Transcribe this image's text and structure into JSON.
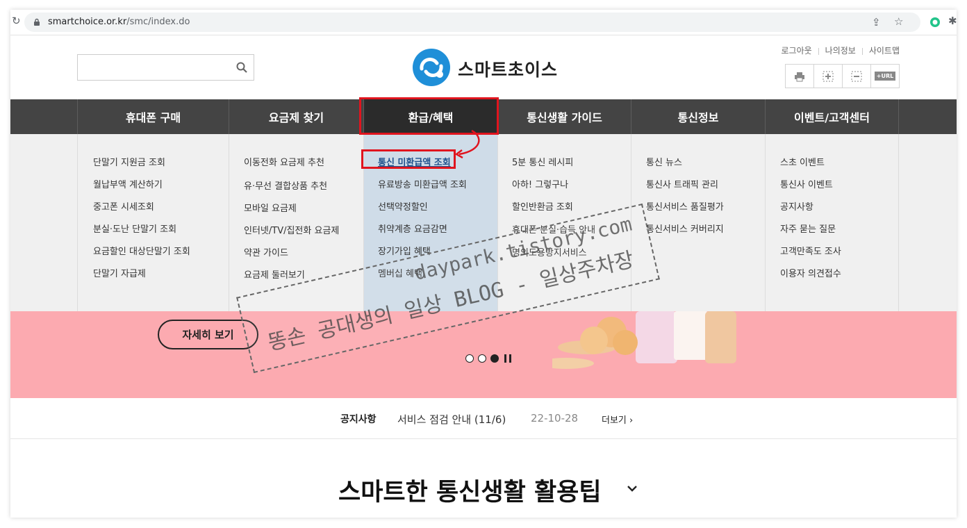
{
  "browser": {
    "url_domain": "smartchoice.or.kr",
    "url_path": "/smc/index.do"
  },
  "header": {
    "search": {
      "placeholder": "",
      "value": ""
    },
    "logo_text": "스마트초이스",
    "util_links": [
      "로그아웃",
      "나의정보",
      "사이트맵"
    ],
    "util_icons": [
      "print-icon",
      "zoom-in-icon",
      "zoom-out-icon",
      "url-icon"
    ],
    "url_icon_label": "+URL"
  },
  "nav": {
    "items": [
      "휴대폰 구매",
      "요금제 찾기",
      "환급/혜택",
      "통신생활 가이드",
      "통신정보",
      "이벤트/고객센터"
    ],
    "active_index": 2
  },
  "dropdown": {
    "columns": [
      [
        "단말기 지원금 조회",
        "월납부액 계산하기",
        "중고폰 시세조회",
        "분실·도난 단말기 조회",
        "요금할인 대상단말기 조회",
        "단말기 자급제"
      ],
      [
        "이동전화 요금제 추천",
        "유·무선 결합상품 추천",
        "모바일 요금제",
        "인터넷/TV/집전화 요금제",
        "약관 가이드",
        "요금제 둘러보기"
      ],
      [
        "통신 미환급액 조회",
        "유료방송 미환급액 조회",
        "선택약정할인",
        "취약계층 요금감면",
        "장기가입 혜택",
        "멤버십 혜택"
      ],
      [
        "5분 통신 레시피",
        "아하! 그렇구나",
        "할인반환금 조회",
        "휴대폰 분실·습득 안내",
        "명의도용방지서비스"
      ],
      [
        "통신 뉴스",
        "통신사 트래픽 관리",
        "통신서비스 품질평가",
        "통신서비스 커버리지"
      ],
      [
        "스초 이벤트",
        "통신사 이벤트",
        "공지사항",
        "자주 묻는 질문",
        "고객만족도 조사",
        "이용자 의견접수"
      ]
    ],
    "selected": {
      "column": 2,
      "item": 0
    }
  },
  "banner": {
    "button_label": "자세히 보기",
    "slides": 3,
    "current_slide": 3
  },
  "notice": {
    "label": "공지사항",
    "title": "서비스 점검 안내 (11/6)",
    "date": "22-10-28",
    "more": "더보기 ›"
  },
  "section": {
    "title": "스마트한 통신생활 활용팁"
  },
  "watermark": {
    "line1": "daypark.tistory.com",
    "line2": "똥손 공대생의 일상 BLOG - 일상주차장"
  },
  "colors": {
    "nav_bg": "#444444",
    "highlight": "#e0141e",
    "banner_bg": "#fcaab0",
    "dropdown_active": "#cfdce8",
    "logo_blue": "#1f8fd8"
  }
}
